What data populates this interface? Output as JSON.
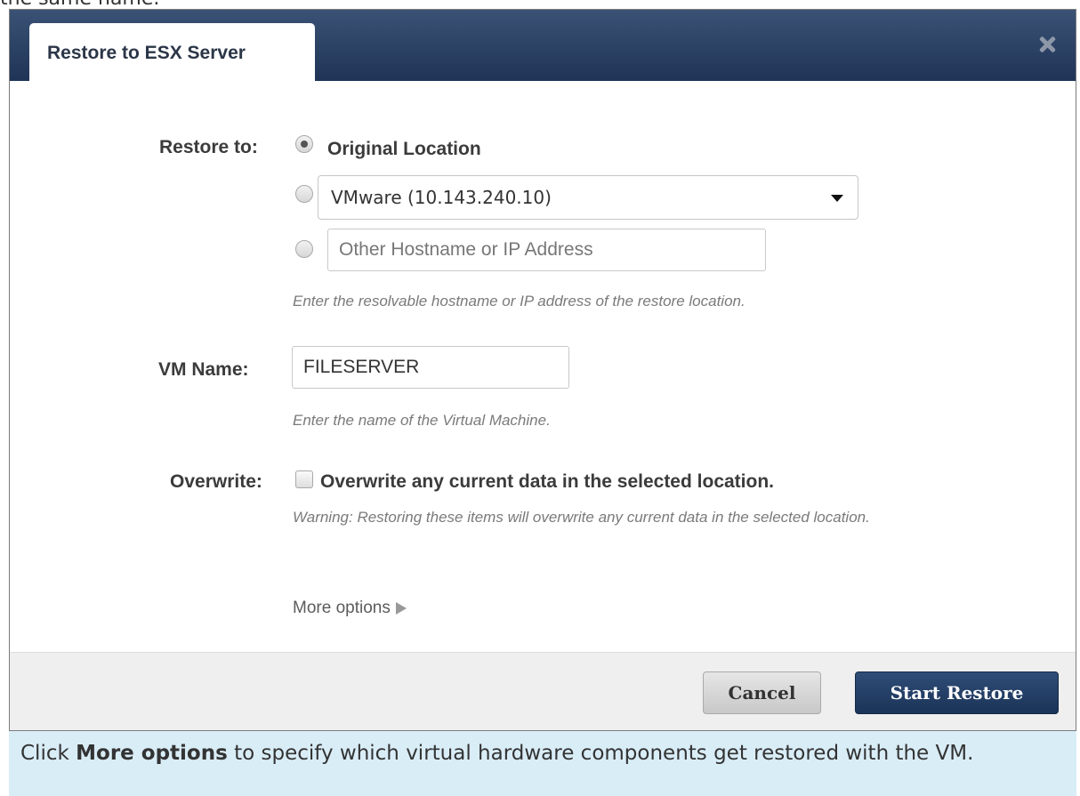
{
  "top_snippet": "the same name.",
  "dialog": {
    "title": "Restore to ESX Server",
    "close_icon": "close-icon",
    "restore_to": {
      "label": "Restore to:",
      "options": [
        {
          "text": "Original Location",
          "selected": true
        },
        {
          "type": "select",
          "value": "VMware (10.143.240.10)",
          "selected": false
        },
        {
          "type": "input",
          "placeholder": "Other Hostname or IP Address",
          "selected": false
        }
      ],
      "hint": "Enter the resolvable hostname or IP address of the restore location."
    },
    "vm_name": {
      "label": "VM Name:",
      "value": "FILESERVER",
      "hint": "Enter the name of the Virtual Machine."
    },
    "overwrite": {
      "label": "Overwrite:",
      "checkbox_label": "Overwrite any current data in the selected location.",
      "checked": false,
      "warning": "Warning: Restoring these items will overwrite any current data in the selected location."
    },
    "more_options": "More options",
    "footer": {
      "cancel": "Cancel",
      "start": "Start Restore"
    }
  },
  "info": {
    "prefix": "Click ",
    "bold": "More options",
    "suffix": " to specify which virtual hardware components get restored with the VM."
  },
  "colors": {
    "titlebar": "#2a4066",
    "primary_button": "#1f3557",
    "info_background": "#d9edf7"
  }
}
